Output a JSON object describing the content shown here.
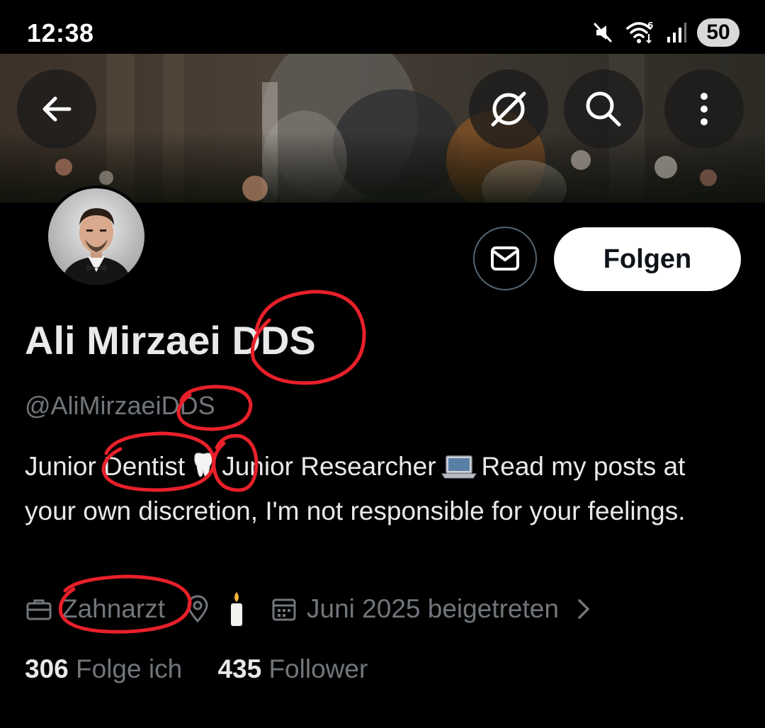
{
  "status_bar": {
    "time": "12:38",
    "battery": "50"
  },
  "header": {
    "back_icon": "arrow-left-icon",
    "grok_icon": "grok-icon",
    "search_icon": "search-icon",
    "more_icon": "more-vertical-icon"
  },
  "profile": {
    "name": "Ali Mirzaei DDS",
    "handle": "@AliMirzaeiDDS",
    "bio": {
      "part1": "Junior Dentist",
      "emoji1": "tooth-emoji",
      "part2": "Junior Researcher",
      "emoji2": "laptop-emoji",
      "part3": "Read my posts at your own discretion, I'm not responsible for your feelings."
    },
    "meta": {
      "category": "Zahnarzt",
      "joined": "Juni 2025 beigetreten"
    },
    "stats": {
      "following_count": "306",
      "following_label": "Folge ich",
      "followers_count": "435",
      "followers_label": "Follower"
    }
  },
  "actions": {
    "follow_label": "Folgen",
    "message_icon": "mail-icon"
  },
  "colors": {
    "background": "#000000",
    "text": "#e7e9ea",
    "muted": "#71767b",
    "annotation": "#e8202a"
  }
}
